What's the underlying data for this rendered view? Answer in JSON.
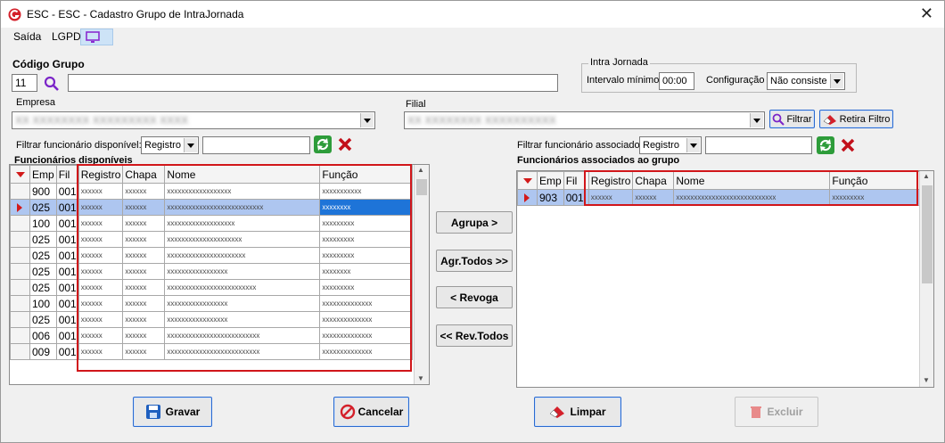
{
  "window": {
    "title": "ESC - ESC - Cadastro Grupo de IntraJornada",
    "close_glyph": "✕"
  },
  "menu": {
    "items": [
      "Saída",
      "LGPD"
    ],
    "icon": "monitor-icon"
  },
  "codigo_grupo": {
    "label": "Código Grupo",
    "value": "11",
    "description": ""
  },
  "intra_jornada": {
    "legend": "Intra Jornada",
    "intervalo_label": "Intervalo mínimo",
    "intervalo_value": "00:00",
    "configuracao_label": "Configuração",
    "configuracao_value": "Não consiste"
  },
  "empresa": {
    "label": "Empresa",
    "value": "XX XXXXXXXX XXXXXXXXX XXXX"
  },
  "filial": {
    "label": "Filial",
    "value": "XX XXXXXXXX XXXXXXXXXX",
    "filtrar_label": "Filtrar",
    "retira_filtro_label": "Retira Filtro"
  },
  "left": {
    "filter_label": "Filtrar funcionário disponível:",
    "filter_select": "Registro",
    "filter_value": "",
    "title": "Funcionários disponíveis",
    "columns": [
      "Emp",
      "Fil",
      "Registro",
      "Chapa",
      "Nome",
      "Função"
    ],
    "rows": [
      [
        "900",
        "001",
        "xxxxxx",
        "xxxxxx",
        "xxxxxxxxxxxxxxxxxx",
        "xxxxxxxxxxx"
      ],
      [
        "025",
        "001",
        "xxxxxx",
        "xxxxxx",
        "xxxxxxxxxxxxxxxxxxxxxxxxxxx",
        "xxxxxxxx"
      ],
      [
        "100",
        "001",
        "xxxxxx",
        "xxxxxx",
        "xxxxxxxxxxxxxxxxxxx",
        "xxxxxxxxx"
      ],
      [
        "025",
        "001",
        "xxxxxx",
        "xxxxxx",
        "xxxxxxxxxxxxxxxxxxxxx",
        "xxxxxxxxx"
      ],
      [
        "025",
        "001",
        "xxxxxx",
        "xxxxxx",
        "xxxxxxxxxxxxxxxxxxxxxx",
        "xxxxxxxxx"
      ],
      [
        "025",
        "001",
        "xxxxxx",
        "xxxxxx",
        "xxxxxxxxxxxxxxxxx",
        "xxxxxxxx"
      ],
      [
        "025",
        "001",
        "xxxxxx",
        "xxxxxx",
        "xxxxxxxxxxxxxxxxxxxxxxxxx",
        "xxxxxxxxx"
      ],
      [
        "100",
        "001",
        "xxxxxx",
        "xxxxxx",
        "xxxxxxxxxxxxxxxxx",
        "xxxxxxxxxxxxxx"
      ],
      [
        "025",
        "001",
        "xxxxxx",
        "xxxxxx",
        "xxxxxxxxxxxxxxxxx",
        "xxxxxxxxxxxxxx"
      ],
      [
        "006",
        "001",
        "xxxxxx",
        "xxxxxx",
        "xxxxxxxxxxxxxxxxxxxxxxxxxx",
        "xxxxxxxxxxxxxx"
      ],
      [
        "009",
        "001",
        "xxxxxx",
        "xxxxxx",
        "xxxxxxxxxxxxxxxxxxxxxxxxxx",
        "xxxxxxxxxxxxxx"
      ]
    ]
  },
  "middle": {
    "agrupa": "Agrupa >",
    "agr_todos": "Agr.Todos >>",
    "revoga": "< Revoga",
    "rev_todos": "<< Rev.Todos"
  },
  "right": {
    "filter_label": "Filtrar funcionário associado:",
    "filter_select": "Registro",
    "filter_value": "",
    "title": "Funcionários associados ao grupo",
    "columns": [
      "Emp",
      "Fil",
      "Registro",
      "Chapa",
      "Nome",
      "Função"
    ],
    "rows": [
      [
        "903",
        "001",
        "xxxxxx",
        "xxxxxx",
        "xxxxxxxxxxxxxxxxxxxxxxxxxxxx",
        "xxxxxxxxx"
      ]
    ]
  },
  "footer": {
    "gravar": "Gravar",
    "cancelar": "Cancelar",
    "limpar": "Limpar",
    "excluir": "Excluir"
  },
  "colors": {
    "accent": "#1e74d8",
    "selection": "#aec6f0",
    "highlight_box": "#d1161a"
  }
}
